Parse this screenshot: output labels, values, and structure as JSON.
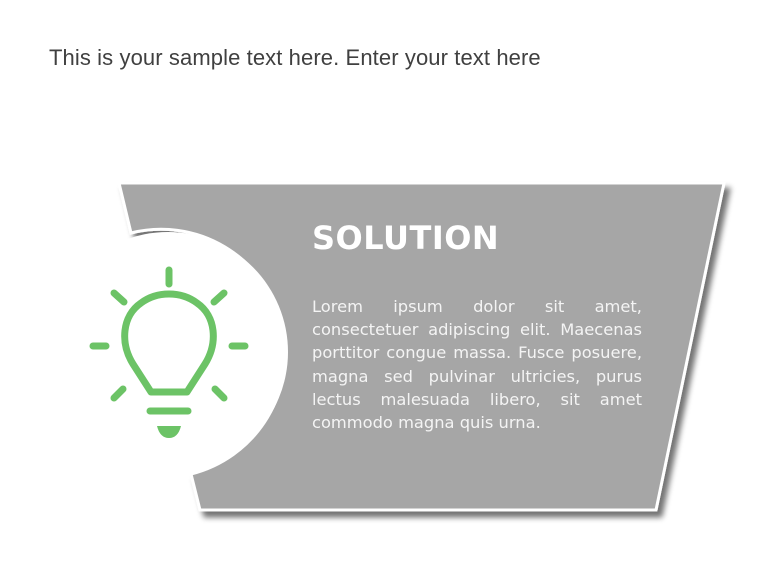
{
  "headline": "This is your sample text here. Enter your text here",
  "card": {
    "title": "SOLUTION",
    "body": "Lorem ipsum dolor sit amet, consectetuer adipiscing elit. Maecenas porttitor congue massa. Fusce posuere, magna sed pulvinar ultricies, purus lectus malesuada libero, sit amet commodo magna quis urna.",
    "icon": "lightbulb-icon"
  },
  "colors": {
    "card_fill": "#a6a6a6",
    "icon_green": "#6cc366",
    "headline_text": "#404040",
    "card_text": "#ffffff"
  }
}
